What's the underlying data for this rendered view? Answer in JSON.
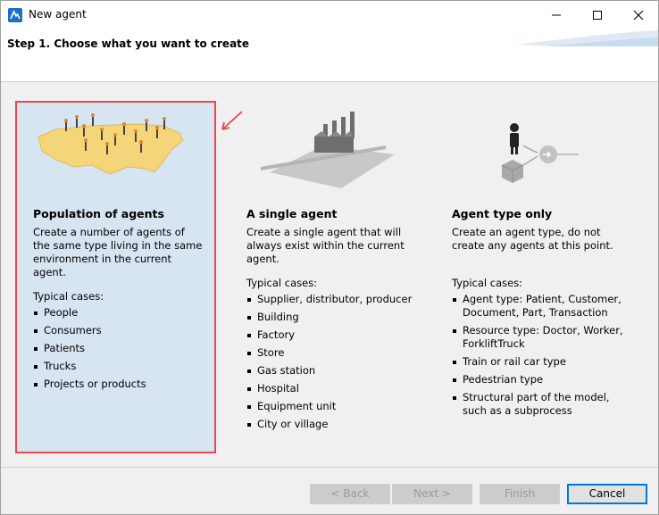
{
  "window": {
    "title": "New agent",
    "icon": "anylogic-icon",
    "controls": [
      "minimize-icon",
      "maximize-icon",
      "close-icon"
    ]
  },
  "header": {
    "step_title": "Step 1. Choose what you want to create"
  },
  "options": [
    {
      "title": "Population of agents",
      "description": "Create a number of agents of the same type living in the same environment in the current agent.",
      "cases_label": "Typical cases:",
      "cases": [
        "People",
        "Consumers",
        "Patients",
        "Trucks",
        "Projects or products"
      ],
      "selected": true
    },
    {
      "title": "A single agent",
      "description": "Create a single agent that will always exist within the current agent.",
      "cases_label": "Typical cases:",
      "cases": [
        "Supplier, distributor, producer",
        "Building",
        "Factory",
        "Store",
        "Gas station",
        "Hospital",
        "Equipment unit",
        "City or village"
      ],
      "selected": false
    },
    {
      "title": "Agent type only",
      "description": "Create an agent type, do not create any agents at this point.",
      "cases_label": "Typical cases:",
      "cases": [
        "Agent type: Patient, Customer, Document, Part, Transaction",
        "Resource type: Doctor, Worker, ForkliftTruck",
        "Train or rail car type",
        "Pedestrian type",
        "Structural part of the model, such as a subprocess"
      ],
      "selected": false
    }
  ],
  "footer": {
    "back": "< Back",
    "next": "Next >",
    "finish": "Finish",
    "cancel": "Cancel"
  },
  "colors": {
    "selection_fill": "#d7e4f2",
    "selection_border": "#e8484c",
    "primary_border": "#0078d7"
  }
}
